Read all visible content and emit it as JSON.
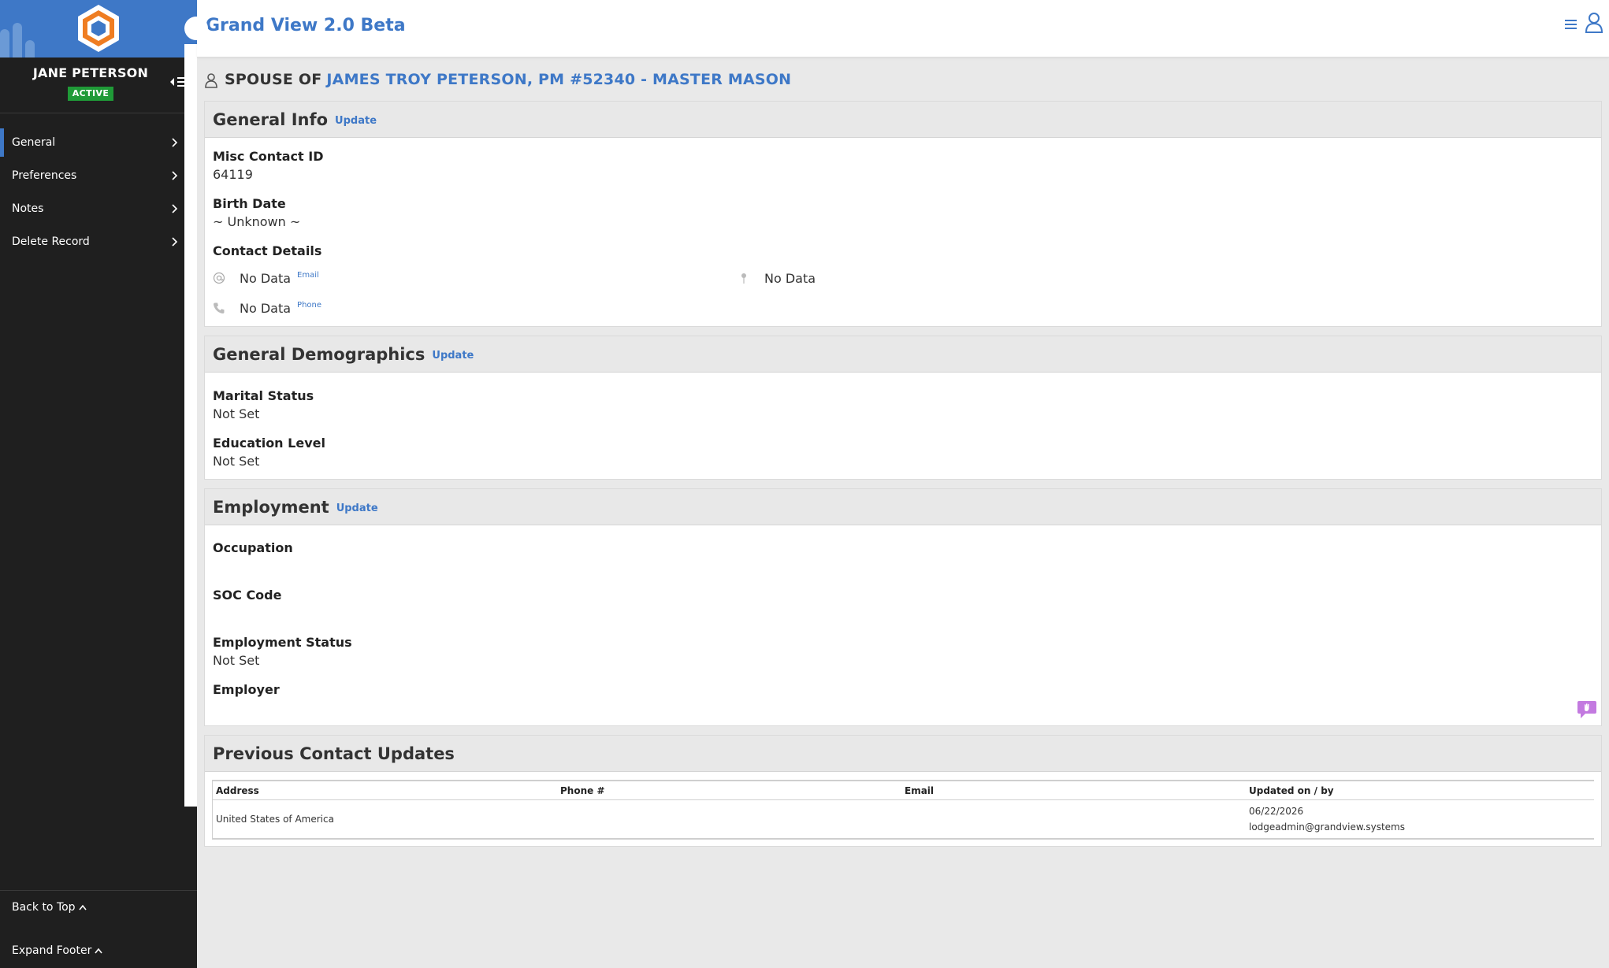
{
  "app": {
    "title": "Grand View 2.0 Beta"
  },
  "sidebar": {
    "user_name": "JANE PETERSON",
    "status": "ACTIVE",
    "items": [
      {
        "label": "General"
      },
      {
        "label": "Preferences"
      },
      {
        "label": "Notes"
      },
      {
        "label": "Delete Record"
      }
    ],
    "back_to_top": "Back to Top",
    "expand_footer": "Expand Footer"
  },
  "page": {
    "spouse_label": "SPOUSE OF",
    "spouse_link": "JAMES TROY PETERSON, PM #52340 - MASTER MASON"
  },
  "general_info": {
    "title": "General Info",
    "update": "Update",
    "misc_id_label": "Misc Contact ID",
    "misc_id_value": "64119",
    "birth_label": "Birth Date",
    "birth_value": "~ Unknown ~",
    "contact_label": "Contact Details",
    "email_value": "No Data",
    "email_tag": "Email",
    "address_value": "No Data",
    "phone_value": "No Data",
    "phone_tag": "Phone"
  },
  "demographics": {
    "title": "General Demographics",
    "update": "Update",
    "marital_label": "Marital Status",
    "marital_value": "Not Set",
    "education_label": "Education Level",
    "education_value": "Not Set"
  },
  "employment": {
    "title": "Employment",
    "update": "Update",
    "occupation_label": "Occupation",
    "occupation_value": "",
    "soc_label": "SOC Code",
    "soc_value": "",
    "status_label": "Employment Status",
    "status_value": "Not Set",
    "employer_label": "Employer",
    "employer_value": ""
  },
  "previous_updates": {
    "title": "Previous Contact Updates",
    "columns": [
      "Address",
      "Phone #",
      "Email",
      "Updated on / by"
    ],
    "rows": [
      {
        "address": "United States of America",
        "phone": "",
        "email": "",
        "updated_on": "06/22/2026",
        "updated_by": "lodgeadmin@grandview.systems"
      }
    ]
  },
  "colors": {
    "accent": "#3e78c7",
    "sidebar": "#1f1f1f",
    "active_badge": "#1f9a37"
  }
}
